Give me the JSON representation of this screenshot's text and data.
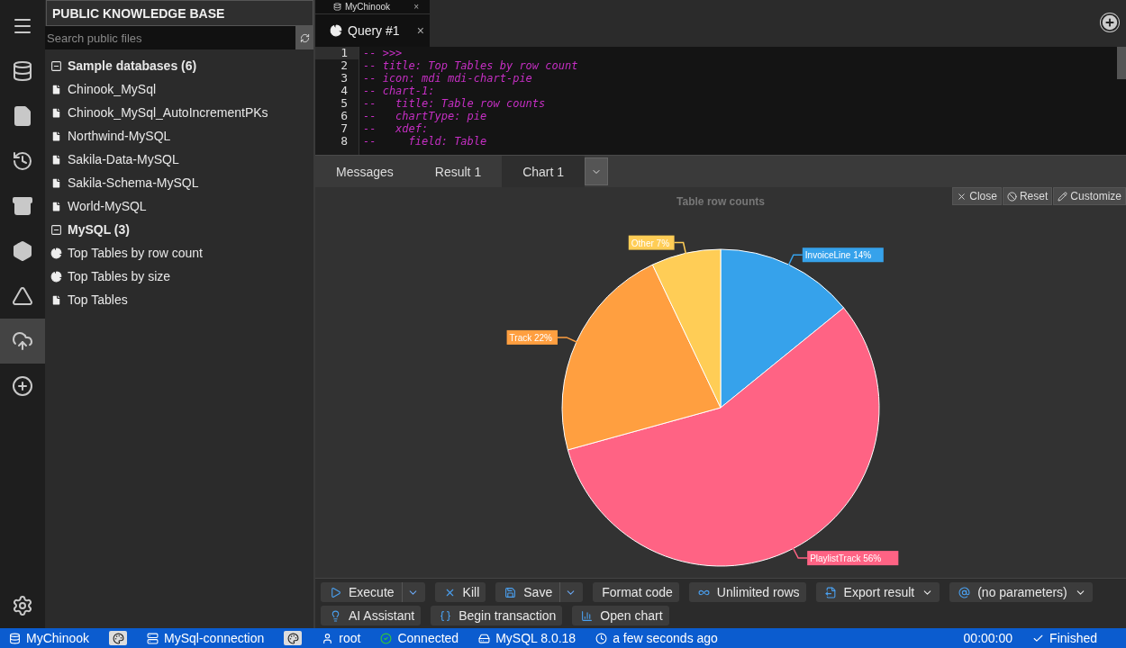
{
  "activity_bar": {
    "items": [
      {
        "selected": false
      },
      {
        "selected": false
      },
      {
        "selected": false
      },
      {
        "selected": false
      },
      {
        "selected": false
      },
      {
        "selected": false
      },
      {
        "selected": true
      },
      {
        "selected": false
      }
    ]
  },
  "sidebar": {
    "title": "PUBLIC KNOWLEDGE BASE",
    "search": {
      "placeholder": "Search public files"
    },
    "tree": [
      {
        "label": "Sample databases (6)",
        "expanded": true,
        "children": [
          {
            "label": "Chinook_MySql",
            "kind": "file"
          },
          {
            "label": "Chinook_MySql_AutoIncrementPKs",
            "kind": "file"
          },
          {
            "label": "Northwind-MySQL",
            "kind": "file"
          },
          {
            "label": "Sakila-Data-MySQL",
            "kind": "file"
          },
          {
            "label": "Sakila-Schema-MySQL",
            "kind": "file"
          },
          {
            "label": "World-MySQL",
            "kind": "file"
          }
        ]
      },
      {
        "label": "MySQL (3)",
        "expanded": true,
        "children": [
          {
            "label": "Top Tables by row count",
            "kind": "chart"
          },
          {
            "label": "Top Tables by size",
            "kind": "chart"
          },
          {
            "label": "Top Tables",
            "kind": "file"
          }
        ]
      }
    ]
  },
  "connection_tab": {
    "label": "MyChinook",
    "close": "×"
  },
  "query_tabs": [
    {
      "label": "Query #1",
      "close": "×",
      "selected": true
    }
  ],
  "editor": {
    "lines": [
      {
        "number": "1",
        "text": "-- >>>"
      },
      {
        "number": "2",
        "text": "-- title: Top Tables by row count"
      },
      {
        "number": "3",
        "text": "-- icon: mdi mdi-chart-pie"
      },
      {
        "number": "4",
        "text": "-- chart-1:"
      },
      {
        "number": "5",
        "text": "--   title: Table row counts"
      },
      {
        "number": "6",
        "text": "--   chartType: pie"
      },
      {
        "number": "7",
        "text": "--   xdef:"
      },
      {
        "number": "8",
        "text": "--     field: Table"
      }
    ]
  },
  "result_tabs": [
    {
      "label": "Messages",
      "selected": false
    },
    {
      "label": "Result 1",
      "selected": false
    },
    {
      "label": "Chart 1",
      "selected": true
    }
  ],
  "chart_actions": [
    "Close",
    "Reset",
    "Customize"
  ],
  "chart": {
    "chart_data": {
      "type": "pie",
      "title": "Table row counts",
      "categories": [
        "InvoiceLine",
        "PlaylistTrack",
        "Track",
        "Other"
      ],
      "values": [
        14,
        56,
        22,
        7
      ],
      "colors": [
        "#36a2eb",
        "#ff6384",
        "#ff9f40",
        "#ffcd56"
      ],
      "value_labels": [
        "14%",
        "56%",
        "22%",
        "7%"
      ]
    }
  },
  "toolbar": {
    "buttons": [
      {
        "label": "Execute",
        "kind": "split"
      },
      {
        "label": "Kill",
        "kind": "plain"
      },
      {
        "label": "Save",
        "kind": "split"
      },
      {
        "label": "Format code",
        "kind": "plain"
      },
      {
        "label": "Unlimited rows",
        "kind": "plain"
      },
      {
        "label": "Export result",
        "kind": "dropdown"
      },
      {
        "label": "(no parameters)",
        "kind": "dropdown"
      },
      {
        "label": "AI Assistant",
        "kind": "plain"
      },
      {
        "label": "Begin transaction",
        "kind": "plain"
      },
      {
        "label": "Open chart",
        "kind": "plain"
      }
    ]
  },
  "status_bar": {
    "left": [
      {
        "label": "MyChinook",
        "kind": "text"
      },
      {
        "kind": "palette"
      },
      {
        "label": "MySql-connection",
        "kind": "text"
      },
      {
        "kind": "palette"
      },
      {
        "label": "root",
        "kind": "text"
      },
      {
        "label": "Connected",
        "kind": "text"
      },
      {
        "label": "MySQL 8.0.18",
        "kind": "text"
      },
      {
        "label": "a few seconds ago",
        "kind": "text"
      }
    ],
    "right": [
      {
        "label": "00:00:00",
        "kind": "text"
      },
      {
        "label": "Finished",
        "kind": "text"
      }
    ]
  }
}
